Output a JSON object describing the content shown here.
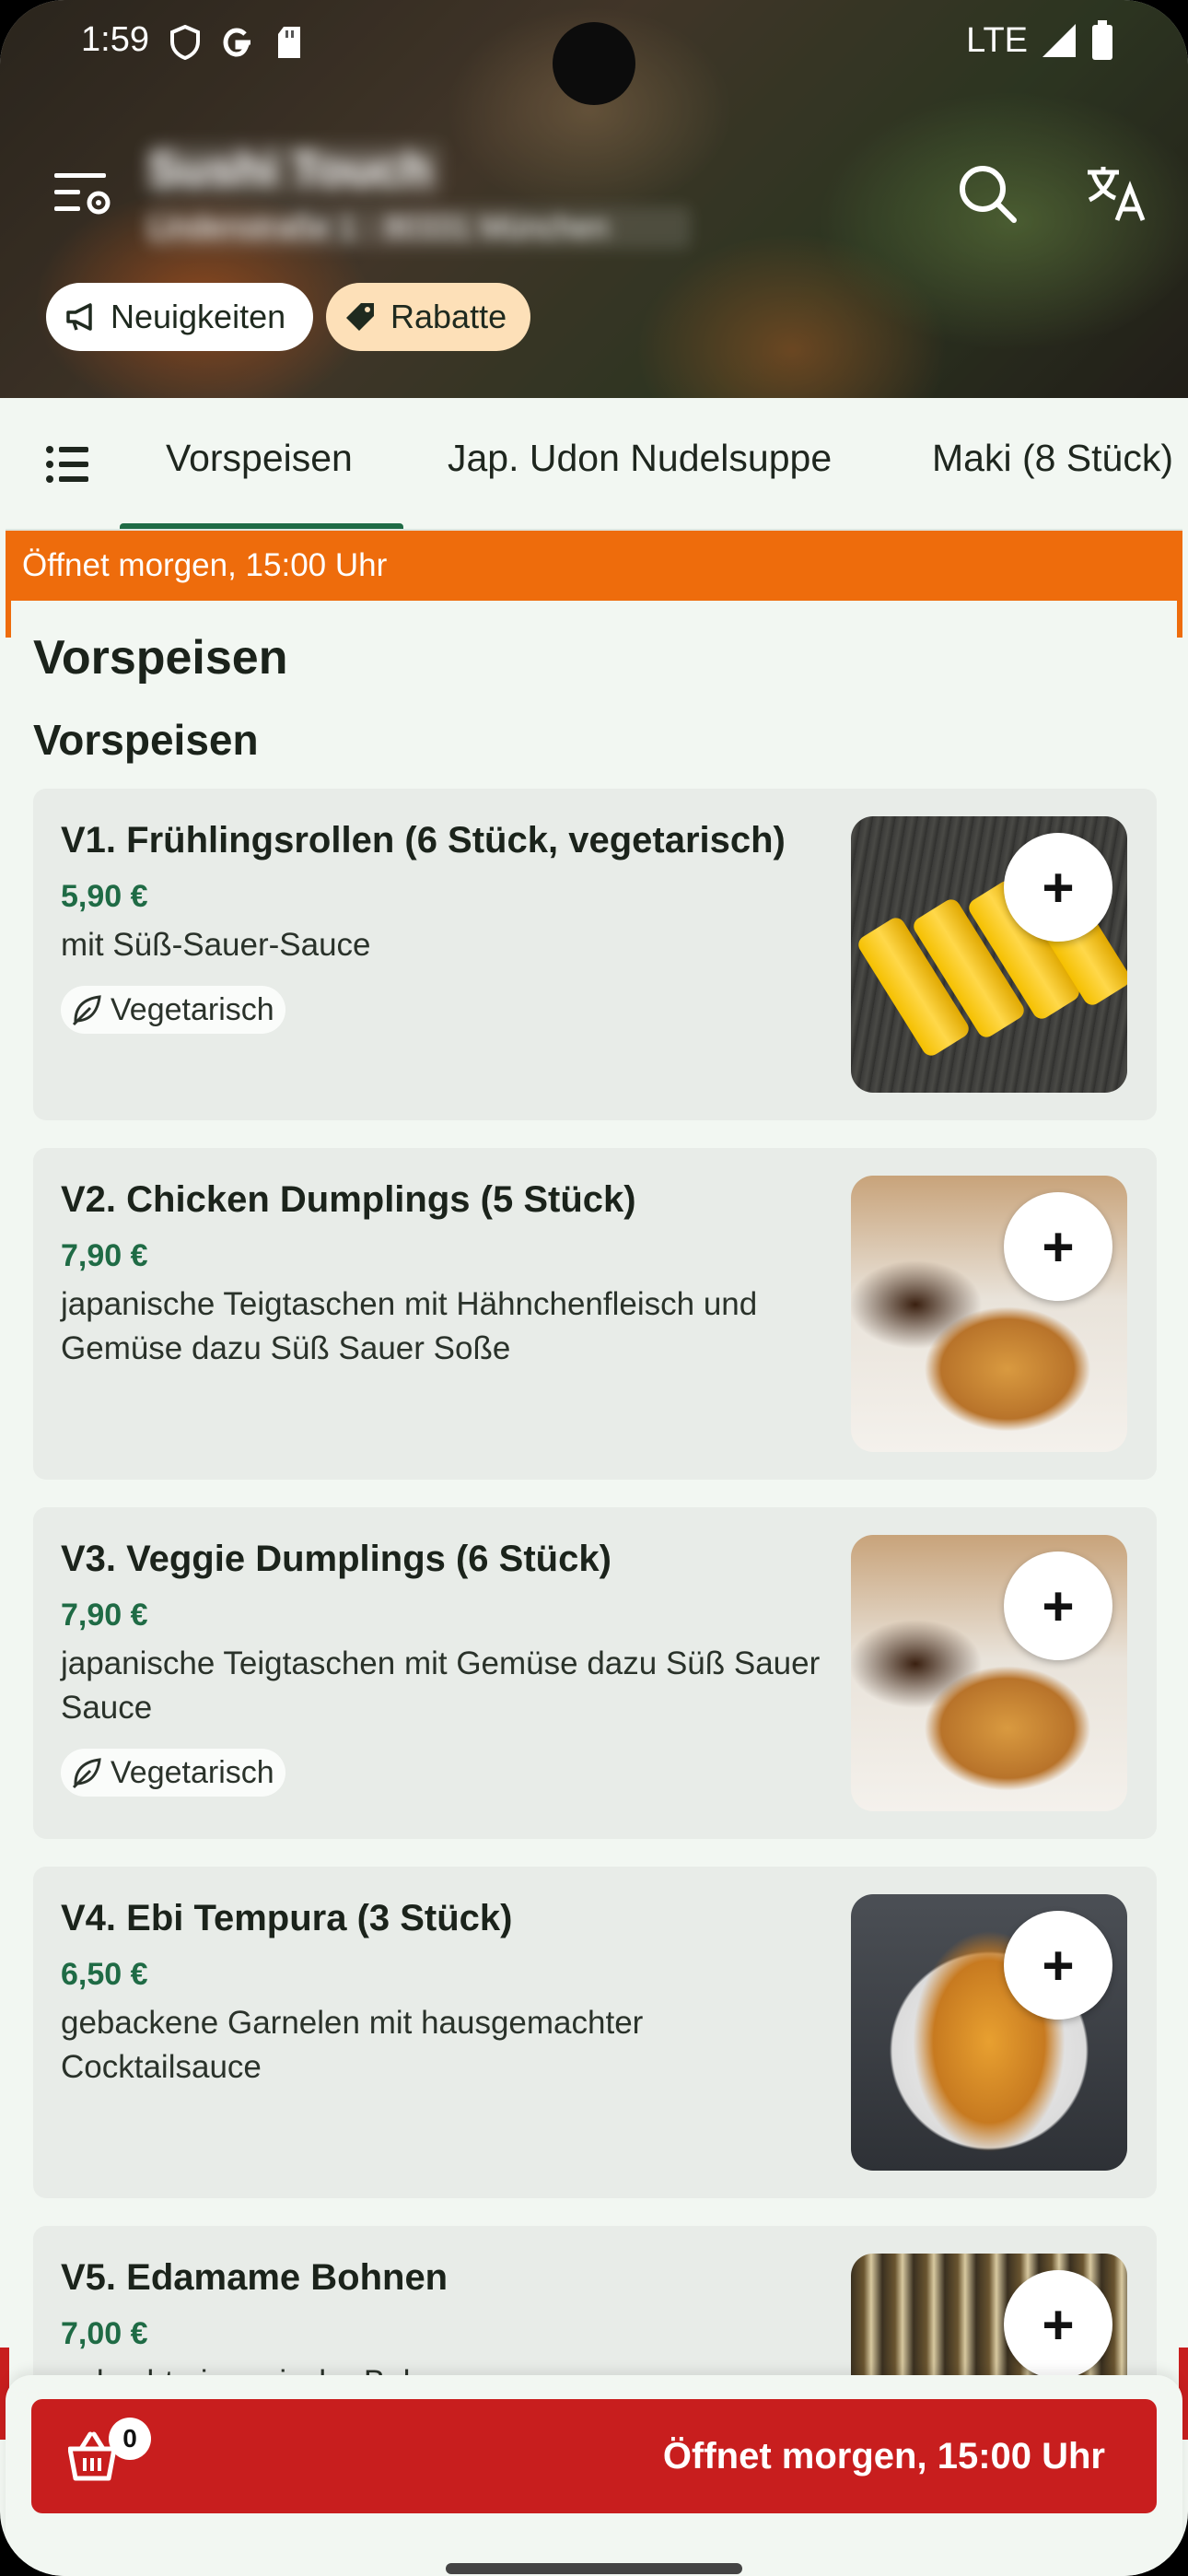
{
  "status_bar": {
    "time": "1:59",
    "network": "LTE"
  },
  "header": {
    "restaurant_name": "Sushi Touch",
    "restaurant_address": "Lindenstraße 1 · 80331 München",
    "chips": {
      "news": "Neuigkeiten",
      "discounts": "Rabatte"
    }
  },
  "tabs": [
    "Vorspeisen",
    "Jap. Udon Nudelsuppe",
    "Maki (8 Stück)"
  ],
  "active_tab": "Vorspeisen",
  "banner": {
    "open_text": "Öffnet morgen, 15:00 Uhr"
  },
  "content": {
    "section_title": "Vorspeisen",
    "subsection_title": "Vorspeisen",
    "items": [
      {
        "name": "V1. Frühlingsrollen (6 Stück, vegetarisch)",
        "price": "5,90 €",
        "description": "mit Süß-Sauer-Sauce",
        "tag": "Vegetarisch"
      },
      {
        "name": "V2. Chicken Dumplings (5 Stück)",
        "price": "7,90 €",
        "description": "japanische Teigtaschen mit Hähnchenfleisch und Gemüse dazu Süß Sauer Soße",
        "tag": ""
      },
      {
        "name": "V3. Veggie Dumplings (6 Stück)",
        "price": "7,90 €",
        "description": "japanische Teigtaschen mit Gemüse dazu Süß Sauer Sauce",
        "tag": "Vegetarisch"
      },
      {
        "name": "V4. Ebi Tempura (3 Stück)",
        "price": "6,50 €",
        "description": "gebackene Garnelen mit hausgemachter Cocktailsauce",
        "tag": ""
      },
      {
        "name": "V5. Edamame Bohnen",
        "price": "7,00 €",
        "description": "gekochte japanische Bohnen",
        "tag": ""
      }
    ],
    "add_symbol": "+"
  },
  "basket": {
    "count": "0",
    "label": "Öffnet morgen, 15:00 Uhr"
  },
  "colors": {
    "accent_green": "#1f6b45",
    "banner_orange": "#ee6c0c",
    "basket_red": "#c81e1e",
    "discount_chip": "#fde0b8"
  },
  "icons": [
    "menu-settings-icon",
    "search-icon",
    "translate-icon",
    "megaphone-icon",
    "tag-icon",
    "list-icon",
    "leaf-icon",
    "basket-icon"
  ]
}
